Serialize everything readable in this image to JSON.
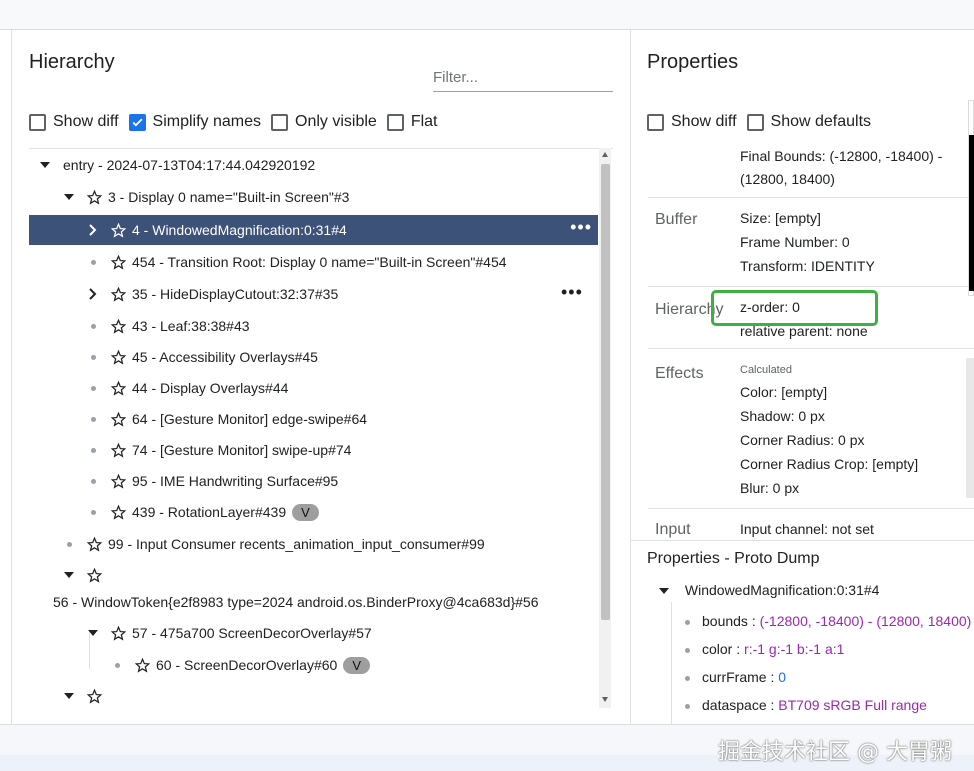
{
  "hierarchy": {
    "title": "Hierarchy",
    "filter_placeholder": "Filter...",
    "options": [
      {
        "label": "Show diff",
        "checked": false
      },
      {
        "label": "Simplify names",
        "checked": true
      },
      {
        "label": "Only visible",
        "checked": false
      },
      {
        "label": "Flat",
        "checked": false
      }
    ],
    "rows": {
      "entry": "entry - 2024-07-13T04:17:44.042920192",
      "display": "3 - Display 0 name=\"Built-in Screen\"#3",
      "windowed": "4 - WindowedMagnification:0:31#4",
      "transition": "454 - Transition Root: Display 0 name=\"Built-in Screen\"#454",
      "hidecutout": "35 - HideDisplayCutout:32:37#35",
      "leaf": "43 - Leaf:38:38#43",
      "accessibility": "45 - Accessibility Overlays#45",
      "displayoverlays": "44 - Display Overlays#44",
      "gesture_edge": "64 - [Gesture Monitor] edge-swipe#64",
      "gesture_up": "74 - [Gesture Monitor] swipe-up#74",
      "ime": "95 - IME Handwriting Surface#95",
      "rotation": "439 - RotationLayer#439",
      "rotation_badge": "V",
      "input_consumer": "99 - Input Consumer recents_animation_input_consumer#99",
      "windowtoken": "56 - WindowToken{e2f8983 type=2024 android.os.BinderProxy@4ca683d}#56",
      "screendecor": "57 - 475a700 ScreenDecorOverlay#57",
      "screendecor60": "60 - ScreenDecorOverlay#60",
      "screendecor60_badge": "V",
      "more_menu": "•••"
    }
  },
  "properties": {
    "title": "Properties",
    "options": [
      {
        "label": "Show diff",
        "checked": false
      },
      {
        "label": "Show defaults",
        "checked": false
      }
    ],
    "final_bounds_1": "Final Bounds: (-12800, -18400) -",
    "final_bounds_2": "(12800, 18400)",
    "buffer": {
      "label": "Buffer",
      "size": "Size: [empty]",
      "frame": "Frame Number: 0",
      "transform": "Transform: IDENTITY"
    },
    "hierarchy": {
      "label": "Hierarchy",
      "zorder": "z-order: 0",
      "relparent": "relative parent: none"
    },
    "effects": {
      "label": "Effects",
      "calculated": "Calculated",
      "color": "Color: [empty]",
      "shadow": "Shadow: 0 px",
      "corner": "Corner Radius: 0 px",
      "crop": "Corner Radius Crop: [empty]",
      "blur": "Blur: 0 px"
    },
    "input": {
      "label": "Input",
      "channel": "Input channel: not set"
    }
  },
  "proto": {
    "title": "Properties - Proto Dump",
    "root": "WindowedMagnification:0:31#4",
    "items": [
      {
        "key": "bounds",
        "sep": " : ",
        "value": "(-12800, -18400) - (12800, 18400)"
      },
      {
        "key": "color",
        "sep": " : ",
        "value": "r:-1 g:-1 b:-1 a:1"
      },
      {
        "key": "currFrame",
        "sep": " : ",
        "value": "0"
      },
      {
        "key": "dataspace",
        "sep": " : ",
        "value": "BT709 sRGB Full range"
      }
    ]
  },
  "watermark": "掘金技术社区 @ 大胃粥",
  "colors": {
    "selected_row": "#3c5278",
    "checkbox_checked": "#1a73e8",
    "highlight_box": "#3cb043",
    "proto_value": "#9c27b0",
    "proto_number": "#1a73e8"
  }
}
